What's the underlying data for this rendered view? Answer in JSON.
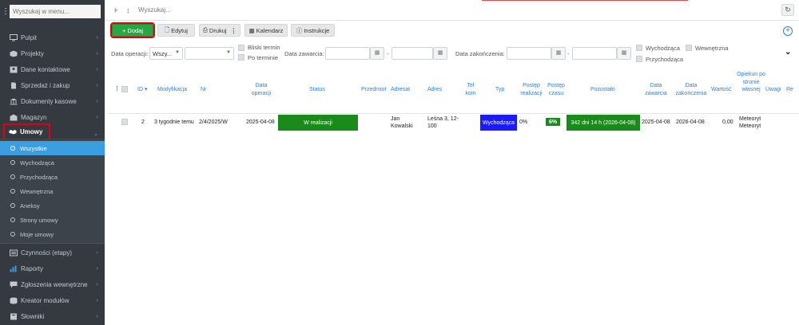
{
  "sidebar": {
    "search_placeholder": "Wyszukaj w menu...",
    "items": [
      {
        "label": "Pulpit",
        "icon": "desktop-icon"
      },
      {
        "label": "Projekty",
        "icon": "box-icon"
      },
      {
        "label": "Dane kontaktowe",
        "icon": "contact-card-icon"
      },
      {
        "label": "Sprzedaż i zakup",
        "icon": "document-icon"
      },
      {
        "label": "Dokumenty kasowe",
        "icon": "bank-icon"
      },
      {
        "label": "Magazyn",
        "icon": "warehouse-icon"
      },
      {
        "label": "Umowy",
        "icon": "handshake-icon"
      }
    ],
    "sub_items": [
      "Wszystkie",
      "Wychodząca",
      "Przychodząca",
      "Wewnętrzna",
      "Aneksy",
      "Strony umowy",
      "Moje umowy"
    ],
    "bottom_items": [
      {
        "label": "Czynności (etapy)",
        "icon": "tasks-icon"
      },
      {
        "label": "Raporty",
        "icon": "chart-icon"
      },
      {
        "label": "Zgłoszenia wewnętrzne",
        "icon": "comment-icon"
      },
      {
        "label": "Kreator modułów",
        "icon": "database-icon"
      },
      {
        "label": "Słowniki",
        "icon": "dictionary-icon"
      }
    ]
  },
  "topbar": {
    "search_placeholder": "Wyszukaj..."
  },
  "toolbar": {
    "add": "+ Dodaj",
    "edit": "Edytuj",
    "print": "Drukuj",
    "calendar": "Kalendarz",
    "instructions": "Instrukcje"
  },
  "filters": {
    "operation_date_label": "Data operacji:",
    "operation_date_select": "Wszy...",
    "near_deadline": "Bliski termin",
    "after_deadline": "Po terminie",
    "conclusion_date_label": "Data zawarcia:",
    "end_date_label": "Data zakończenia:",
    "range_sep": "-",
    "outgoing": "Wychodząca",
    "internal": "Wewnętrzna",
    "incoming": "Przychodząca"
  },
  "table": {
    "headers": {
      "id": "ID",
      "modification": "Modyfikacja",
      "nr": "Nr",
      "operation_date": "Data operacji",
      "status": "Status",
      "subject": "Przedmiot",
      "addressee": "Adresat",
      "address": "Adres",
      "phone": "Tel kom",
      "type": "Typ",
      "realization_progress": "Postęp realizacji",
      "time_progress": "Postęp czasu",
      "remaining": "Pozostało",
      "conclusion_date": "Data zawarcia",
      "end_date": "Data zakończenia",
      "value": "Wartość",
      "own_guardian": "Opiekun po stronie własnej",
      "notes": "Uwagi",
      "extra": "Re"
    },
    "rows": [
      {
        "id": "2",
        "modification": "3 tygodnie temu",
        "nr": "2/4/2025/W",
        "operation_date": "2025-04-08",
        "status": "W realizacji",
        "addressee": "Jan Kowalski",
        "address": "Leśna 3, 12-100",
        "type": "Wychodząca",
        "realization_progress": "0%",
        "time_progress": "6%",
        "remaining": "342 dni 14 h (2026-04-08)",
        "conclusion_date": "2025-04-08",
        "end_date": "2026-04-08",
        "value": "0,00",
        "own_guardian": "Meteoryt Meteoryt"
      }
    ]
  },
  "colors": {
    "sidebar": "#343a40",
    "active": "#3a9ee0",
    "add_button": "#28a745",
    "status": "#1a8a1a",
    "type": "#1a1aff",
    "link": "#2f7fd9",
    "highlight": "#e00012"
  }
}
